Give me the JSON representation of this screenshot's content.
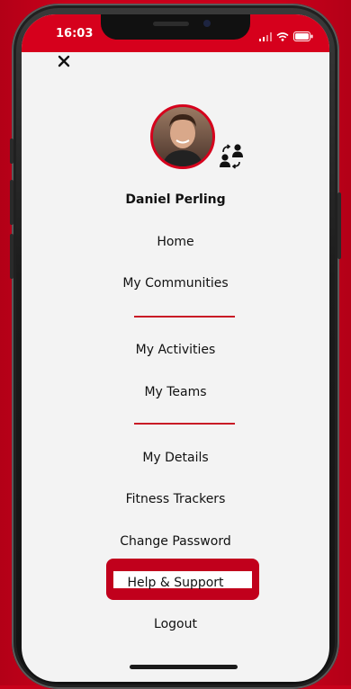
{
  "status_bar": {
    "time": "16:03"
  },
  "profile": {
    "name": "Daniel Perling"
  },
  "menu": {
    "home": "Home",
    "my_communities": "My Communities",
    "my_activities": "My Activities",
    "my_teams": "My Teams",
    "my_details": "My Details",
    "fitness_trackers": "Fitness Trackers",
    "change_password": "Change Password",
    "help_support": "Help & Support",
    "logout": "Logout"
  },
  "icons": {
    "close": "close-icon",
    "switch_account": "switch-account-icon",
    "signal": "signal-icon",
    "wifi": "wifi-icon",
    "battery": "battery-icon"
  },
  "colors": {
    "brand_red": "#d6001c",
    "divider_red": "#c91a25",
    "highlight_red": "#c1001c",
    "menu_background": "#f3f3f3"
  }
}
